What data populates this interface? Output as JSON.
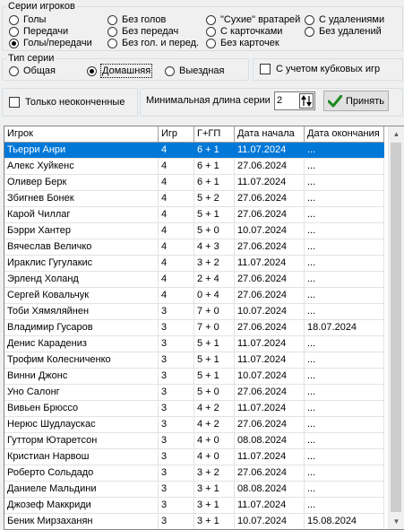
{
  "series_group": {
    "legend": "Серии игроков",
    "options": [
      {
        "label": "Голы",
        "checked": false
      },
      {
        "label": "Передачи",
        "checked": false
      },
      {
        "label": "Голы/передачи",
        "checked": true
      },
      {
        "label": "Без голов",
        "checked": false
      },
      {
        "label": "Без передач",
        "checked": false
      },
      {
        "label": "Без гол. и перед.",
        "checked": false
      },
      {
        "label": "\"Сухие\" вратарей",
        "checked": false
      },
      {
        "label": "С карточками",
        "checked": false
      },
      {
        "label": "Без карточек",
        "checked": false
      },
      {
        "label": "С удалениями",
        "checked": false
      },
      {
        "label": "Без удалений",
        "checked": false
      }
    ]
  },
  "type_group": {
    "legend": "Тип серии",
    "options": [
      {
        "label": "Общая",
        "checked": false
      },
      {
        "label": "Домашняя",
        "checked": true
      },
      {
        "label": "Выездная",
        "checked": false
      }
    ]
  },
  "cup_checkbox": {
    "label": "С учетом кубковых игр",
    "checked": false
  },
  "unfinished_checkbox": {
    "label": "Только неоконченные",
    "checked": false
  },
  "min_length": {
    "label": "Минимальная длина серии",
    "value": "2"
  },
  "accept_button": {
    "label": "Принять"
  },
  "table": {
    "columns": [
      "Игрок",
      "Игр",
      "Г+ГП",
      "Дата начала",
      "Дата окончания"
    ],
    "rows": [
      [
        "Тьерри Анри",
        "4",
        "6 + 1",
        "11.07.2024",
        "..."
      ],
      [
        "Алекс Хуйкенс",
        "4",
        "6 + 1",
        "27.06.2024",
        "..."
      ],
      [
        "Оливер Берк",
        "4",
        "6 + 1",
        "11.07.2024",
        "..."
      ],
      [
        "Збигнев Бонек",
        "4",
        "5 + 2",
        "27.06.2024",
        "..."
      ],
      [
        "Карой Чиллаг",
        "4",
        "5 + 1",
        "27.06.2024",
        "..."
      ],
      [
        "Бэрри Хантер",
        "4",
        "5 + 0",
        "10.07.2024",
        "..."
      ],
      [
        "Вячеслав Величко",
        "4",
        "4 + 3",
        "27.06.2024",
        "..."
      ],
      [
        "Ираклис Гугулакис",
        "4",
        "3 + 2",
        "11.07.2024",
        "..."
      ],
      [
        "Эрленд Холанд",
        "4",
        "2 + 4",
        "27.06.2024",
        "..."
      ],
      [
        "Сергей Ковальчук",
        "4",
        "0 + 4",
        "27.06.2024",
        "..."
      ],
      [
        "Тоби Хямяляйнен",
        "3",
        "7 + 0",
        "10.07.2024",
        "..."
      ],
      [
        "Владимир Гусаров",
        "3",
        "7 + 0",
        "27.06.2024",
        "18.07.2024"
      ],
      [
        "Денис Карадениз",
        "3",
        "5 + 1",
        "11.07.2024",
        "..."
      ],
      [
        "Трофим Колесниченко",
        "3",
        "5 + 1",
        "11.07.2024",
        "..."
      ],
      [
        "Винни Джонс",
        "3",
        "5 + 1",
        "10.07.2024",
        "..."
      ],
      [
        "Уно Салонг",
        "3",
        "5 + 0",
        "27.06.2024",
        "..."
      ],
      [
        "Вивьен Брюссо",
        "3",
        "4 + 2",
        "11.07.2024",
        "..."
      ],
      [
        "Нерюс Шудлаускас",
        "3",
        "4 + 2",
        "27.06.2024",
        "..."
      ],
      [
        "Гутторм Ютаретсон",
        "3",
        "4 + 0",
        "08.08.2024",
        "..."
      ],
      [
        "Кристиан Нарвош",
        "3",
        "4 + 0",
        "11.07.2024",
        "..."
      ],
      [
        "Роберто Сольдадо",
        "3",
        "3 + 2",
        "27.06.2024",
        "..."
      ],
      [
        "Даниеле Мальдини",
        "3",
        "3 + 1",
        "08.08.2024",
        "..."
      ],
      [
        "Джозеф Маккриди",
        "3",
        "3 + 1",
        "11.07.2024",
        "..."
      ],
      [
        "Беник Мирзаханян",
        "3",
        "3 + 1",
        "10.07.2024",
        "15.08.2024"
      ]
    ]
  }
}
